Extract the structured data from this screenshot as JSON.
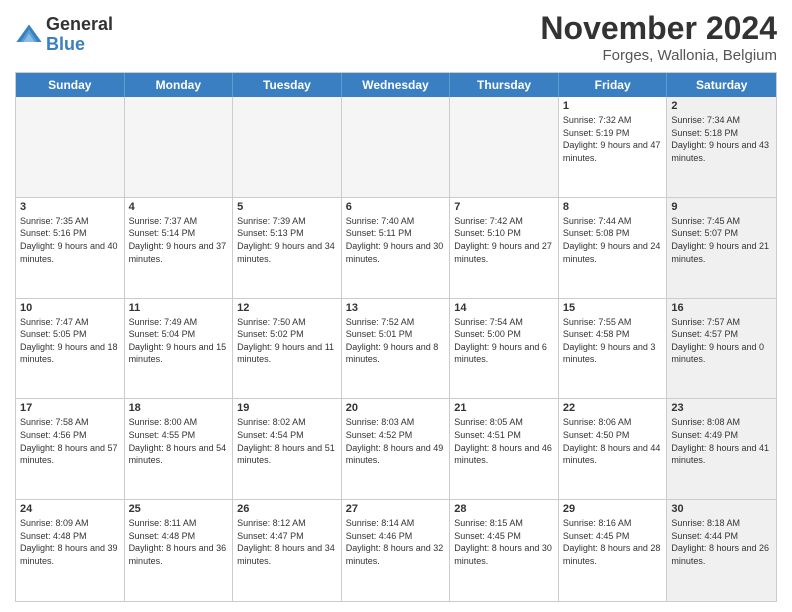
{
  "header": {
    "logo_line1": "General",
    "logo_line2": "Blue",
    "month_title": "November 2024",
    "location": "Forges, Wallonia, Belgium"
  },
  "weekdays": [
    "Sunday",
    "Monday",
    "Tuesday",
    "Wednesday",
    "Thursday",
    "Friday",
    "Saturday"
  ],
  "weeks": [
    [
      {
        "day": "",
        "info": "",
        "empty": true
      },
      {
        "day": "",
        "info": "",
        "empty": true
      },
      {
        "day": "",
        "info": "",
        "empty": true
      },
      {
        "day": "",
        "info": "",
        "empty": true
      },
      {
        "day": "",
        "info": "",
        "empty": true
      },
      {
        "day": "1",
        "info": "Sunrise: 7:32 AM\nSunset: 5:19 PM\nDaylight: 9 hours and 47 minutes.",
        "empty": false,
        "shaded": false
      },
      {
        "day": "2",
        "info": "Sunrise: 7:34 AM\nSunset: 5:18 PM\nDaylight: 9 hours and 43 minutes.",
        "empty": false,
        "shaded": true
      }
    ],
    [
      {
        "day": "3",
        "info": "Sunrise: 7:35 AM\nSunset: 5:16 PM\nDaylight: 9 hours and 40 minutes.",
        "empty": false,
        "shaded": false
      },
      {
        "day": "4",
        "info": "Sunrise: 7:37 AM\nSunset: 5:14 PM\nDaylight: 9 hours and 37 minutes.",
        "empty": false,
        "shaded": false
      },
      {
        "day": "5",
        "info": "Sunrise: 7:39 AM\nSunset: 5:13 PM\nDaylight: 9 hours and 34 minutes.",
        "empty": false,
        "shaded": false
      },
      {
        "day": "6",
        "info": "Sunrise: 7:40 AM\nSunset: 5:11 PM\nDaylight: 9 hours and 30 minutes.",
        "empty": false,
        "shaded": false
      },
      {
        "day": "7",
        "info": "Sunrise: 7:42 AM\nSunset: 5:10 PM\nDaylight: 9 hours and 27 minutes.",
        "empty": false,
        "shaded": false
      },
      {
        "day": "8",
        "info": "Sunrise: 7:44 AM\nSunset: 5:08 PM\nDaylight: 9 hours and 24 minutes.",
        "empty": false,
        "shaded": false
      },
      {
        "day": "9",
        "info": "Sunrise: 7:45 AM\nSunset: 5:07 PM\nDaylight: 9 hours and 21 minutes.",
        "empty": false,
        "shaded": true
      }
    ],
    [
      {
        "day": "10",
        "info": "Sunrise: 7:47 AM\nSunset: 5:05 PM\nDaylight: 9 hours and 18 minutes.",
        "empty": false,
        "shaded": false
      },
      {
        "day": "11",
        "info": "Sunrise: 7:49 AM\nSunset: 5:04 PM\nDaylight: 9 hours and 15 minutes.",
        "empty": false,
        "shaded": false
      },
      {
        "day": "12",
        "info": "Sunrise: 7:50 AM\nSunset: 5:02 PM\nDaylight: 9 hours and 11 minutes.",
        "empty": false,
        "shaded": false
      },
      {
        "day": "13",
        "info": "Sunrise: 7:52 AM\nSunset: 5:01 PM\nDaylight: 9 hours and 8 minutes.",
        "empty": false,
        "shaded": false
      },
      {
        "day": "14",
        "info": "Sunrise: 7:54 AM\nSunset: 5:00 PM\nDaylight: 9 hours and 6 minutes.",
        "empty": false,
        "shaded": false
      },
      {
        "day": "15",
        "info": "Sunrise: 7:55 AM\nSunset: 4:58 PM\nDaylight: 9 hours and 3 minutes.",
        "empty": false,
        "shaded": false
      },
      {
        "day": "16",
        "info": "Sunrise: 7:57 AM\nSunset: 4:57 PM\nDaylight: 9 hours and 0 minutes.",
        "empty": false,
        "shaded": true
      }
    ],
    [
      {
        "day": "17",
        "info": "Sunrise: 7:58 AM\nSunset: 4:56 PM\nDaylight: 8 hours and 57 minutes.",
        "empty": false,
        "shaded": false
      },
      {
        "day": "18",
        "info": "Sunrise: 8:00 AM\nSunset: 4:55 PM\nDaylight: 8 hours and 54 minutes.",
        "empty": false,
        "shaded": false
      },
      {
        "day": "19",
        "info": "Sunrise: 8:02 AM\nSunset: 4:54 PM\nDaylight: 8 hours and 51 minutes.",
        "empty": false,
        "shaded": false
      },
      {
        "day": "20",
        "info": "Sunrise: 8:03 AM\nSunset: 4:52 PM\nDaylight: 8 hours and 49 minutes.",
        "empty": false,
        "shaded": false
      },
      {
        "day": "21",
        "info": "Sunrise: 8:05 AM\nSunset: 4:51 PM\nDaylight: 8 hours and 46 minutes.",
        "empty": false,
        "shaded": false
      },
      {
        "day": "22",
        "info": "Sunrise: 8:06 AM\nSunset: 4:50 PM\nDaylight: 8 hours and 44 minutes.",
        "empty": false,
        "shaded": false
      },
      {
        "day": "23",
        "info": "Sunrise: 8:08 AM\nSunset: 4:49 PM\nDaylight: 8 hours and 41 minutes.",
        "empty": false,
        "shaded": true
      }
    ],
    [
      {
        "day": "24",
        "info": "Sunrise: 8:09 AM\nSunset: 4:48 PM\nDaylight: 8 hours and 39 minutes.",
        "empty": false,
        "shaded": false
      },
      {
        "day": "25",
        "info": "Sunrise: 8:11 AM\nSunset: 4:48 PM\nDaylight: 8 hours and 36 minutes.",
        "empty": false,
        "shaded": false
      },
      {
        "day": "26",
        "info": "Sunrise: 8:12 AM\nSunset: 4:47 PM\nDaylight: 8 hours and 34 minutes.",
        "empty": false,
        "shaded": false
      },
      {
        "day": "27",
        "info": "Sunrise: 8:14 AM\nSunset: 4:46 PM\nDaylight: 8 hours and 32 minutes.",
        "empty": false,
        "shaded": false
      },
      {
        "day": "28",
        "info": "Sunrise: 8:15 AM\nSunset: 4:45 PM\nDaylight: 8 hours and 30 minutes.",
        "empty": false,
        "shaded": false
      },
      {
        "day": "29",
        "info": "Sunrise: 8:16 AM\nSunset: 4:45 PM\nDaylight: 8 hours and 28 minutes.",
        "empty": false,
        "shaded": false
      },
      {
        "day": "30",
        "info": "Sunrise: 8:18 AM\nSunset: 4:44 PM\nDaylight: 8 hours and 26 minutes.",
        "empty": false,
        "shaded": true
      }
    ]
  ]
}
